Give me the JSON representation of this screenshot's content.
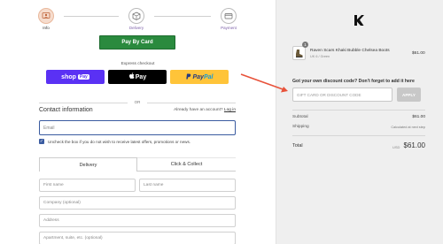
{
  "stepper": {
    "steps": [
      {
        "label": "Info"
      },
      {
        "label": "Delivery"
      },
      {
        "label": "Payment"
      }
    ]
  },
  "payment": {
    "pay_by_card": "Pay By Card",
    "express_title": "Express checkout",
    "shoppay_label": "shop",
    "shoppay_suffix": "Pay",
    "applepay_label": "Pay",
    "paypal_label_a": "Pay",
    "paypal_label_b": "Pal",
    "or_text": "OR"
  },
  "contact": {
    "title": "Contact information",
    "login_prompt": "Already have an account?",
    "login_link": "Log in",
    "email_placeholder": "Email",
    "checkbox_label": "Uncheck the box if you do not wish to receive latest offers, promotions or news."
  },
  "tabs": [
    {
      "label": "Delivery"
    },
    {
      "label": "Click & Collect"
    }
  ],
  "address": {
    "first_name": "First name",
    "last_name": "Last name",
    "company": "Company (optional)",
    "address": "Address",
    "apartment": "Apartment, suite, etc. (optional)"
  },
  "order": {
    "product_name": "Raven Scars Khaki Bubble Chelsea Boots",
    "product_variant": "UK 6 / Green",
    "product_price": "$61.00",
    "quantity": "1",
    "discount_title": "Got your own discount code? Don't forget to add it here",
    "discount_placeholder": "GIFT CARD OR DISCOUNT CODE",
    "apply_label": "APPLY",
    "subtotal_label": "Subtotal",
    "subtotal_value": "$61.00",
    "shipping_label": "Shipping",
    "shipping_value": "Calculated at next step",
    "total_label": "Total",
    "total_currency": "USD",
    "total_value": "$61.00"
  },
  "colors": {
    "accent_purple": "#7b5ea7",
    "pay_green": "#2a8a3e",
    "annotation_arrow": "#e8523a",
    "email_border": "#3a5ba0"
  }
}
